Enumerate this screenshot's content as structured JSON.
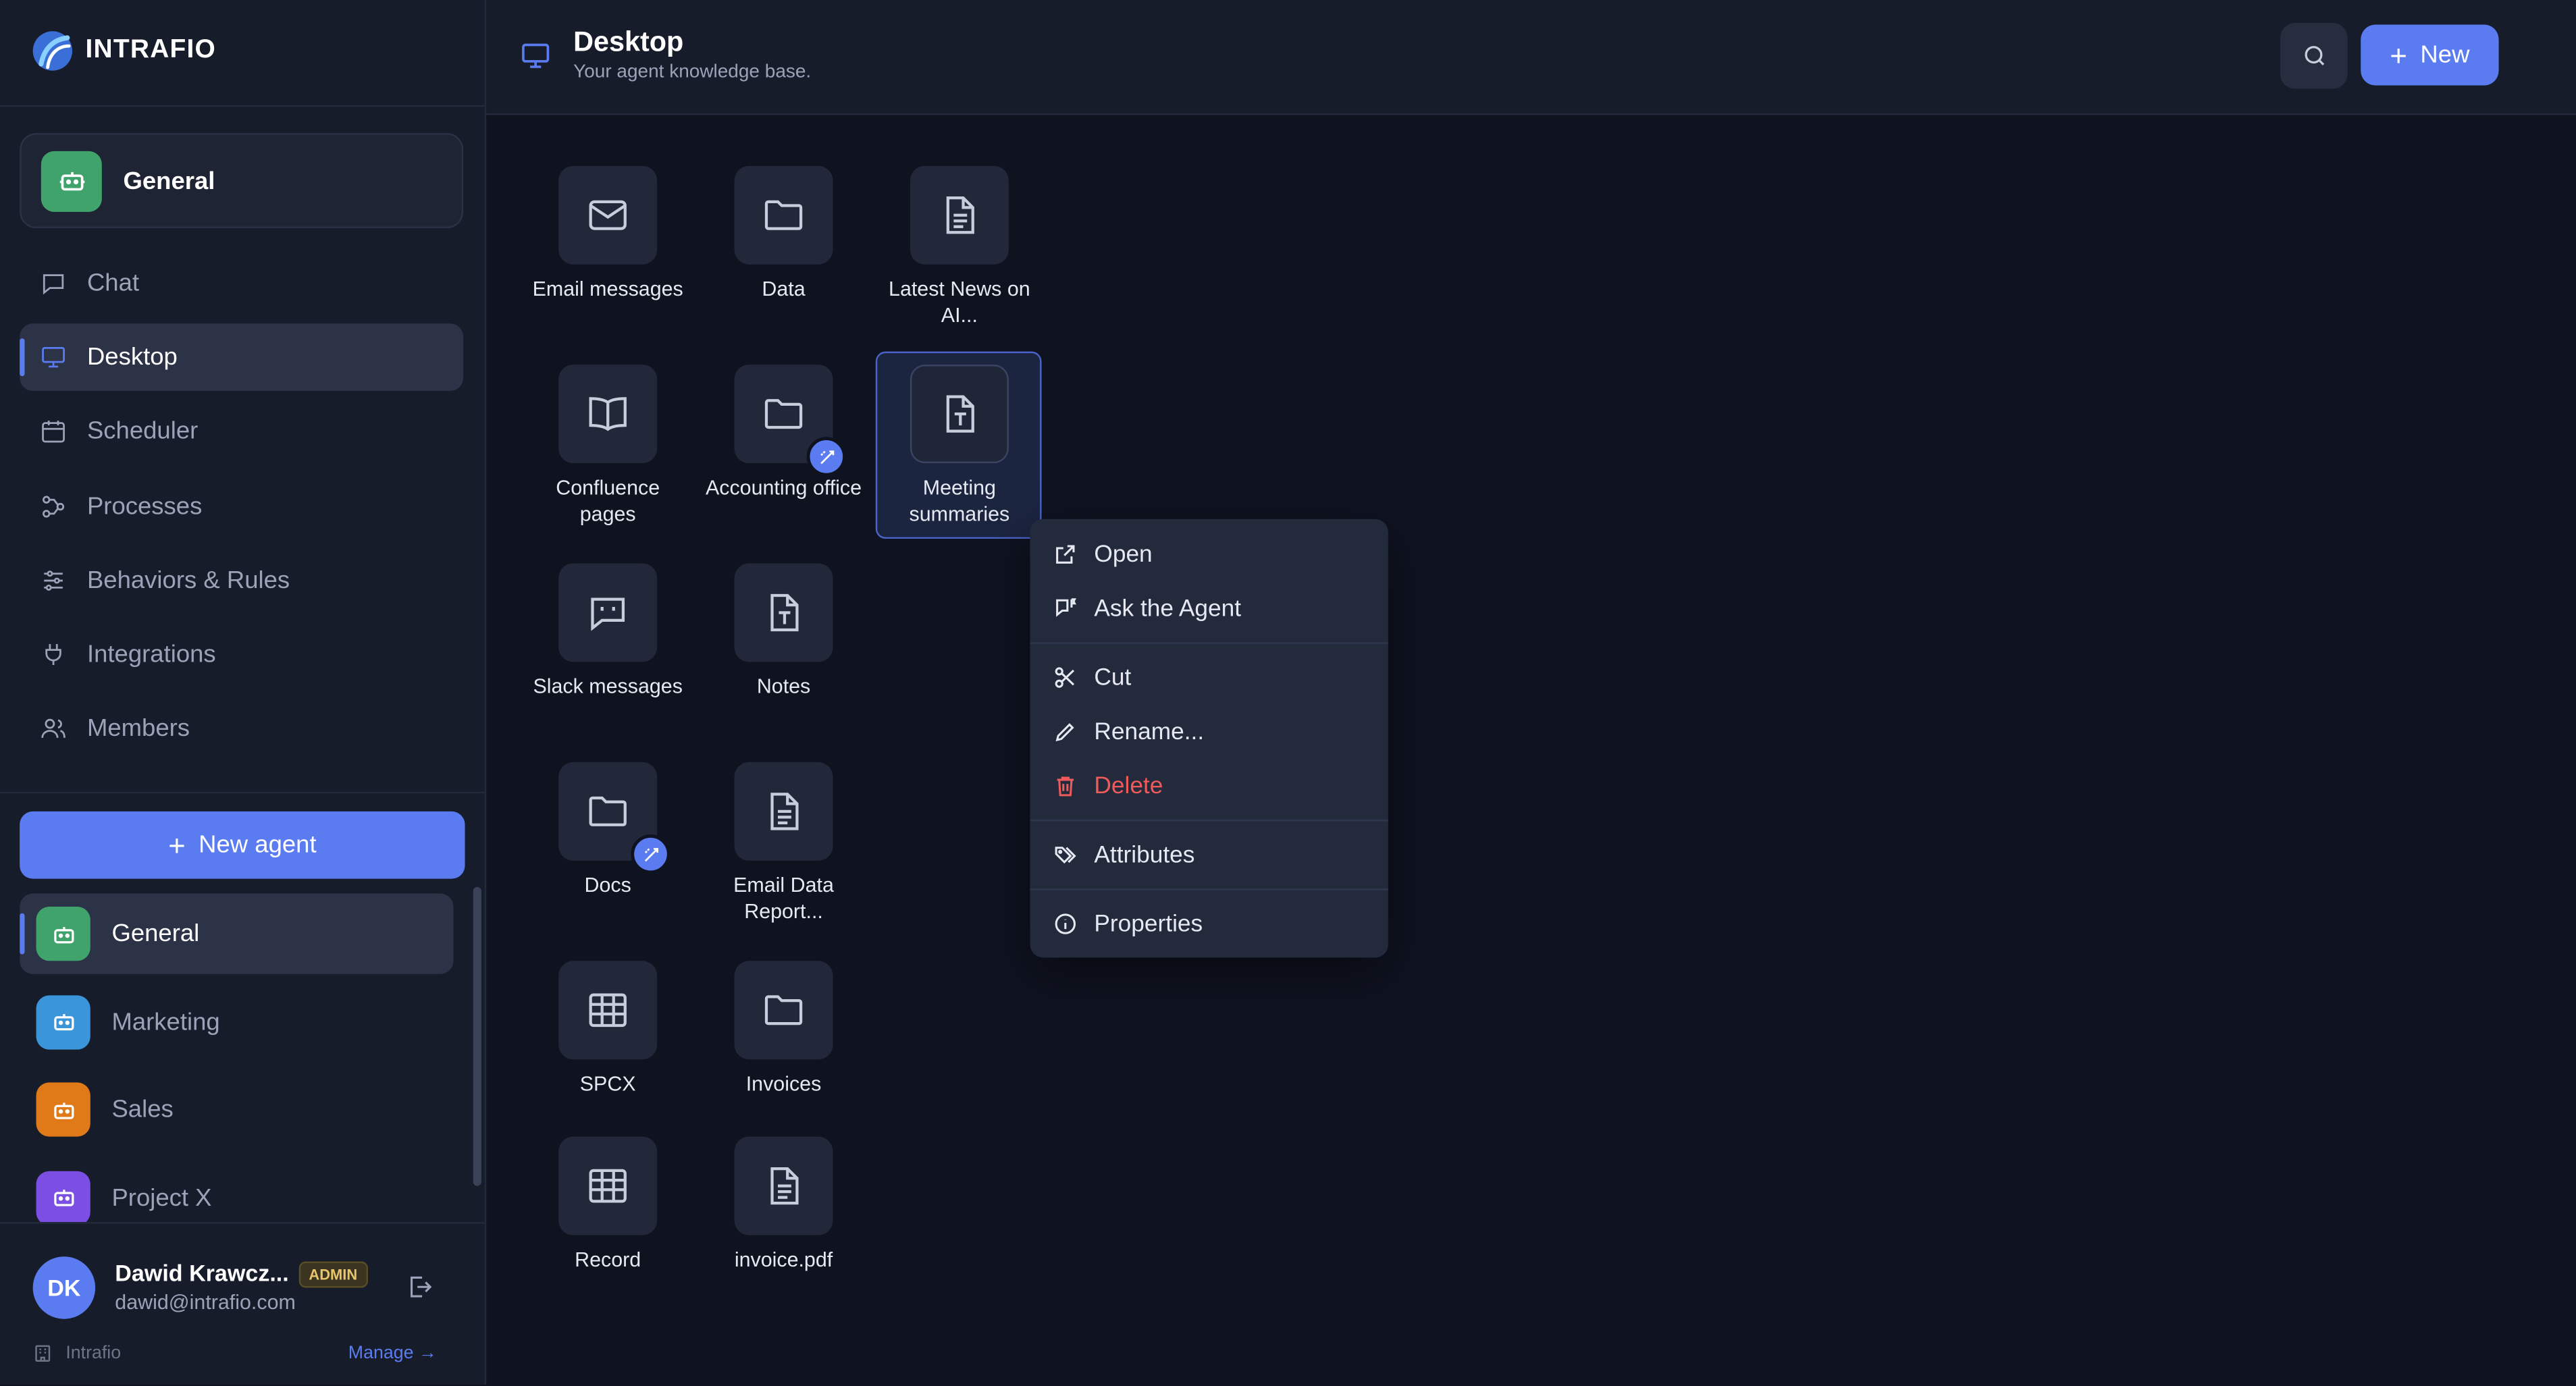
{
  "brand": {
    "name": "INTRAFIO"
  },
  "workspace": {
    "name": "General"
  },
  "nav": [
    {
      "label": "Chat",
      "icon": "chat-icon"
    },
    {
      "label": "Desktop",
      "icon": "monitor-icon",
      "active": true
    },
    {
      "label": "Scheduler",
      "icon": "calendar-icon"
    },
    {
      "label": "Processes",
      "icon": "workflow-icon"
    },
    {
      "label": "Behaviors & Rules",
      "icon": "sliders-icon"
    },
    {
      "label": "Integrations",
      "icon": "plug-icon"
    },
    {
      "label": "Members",
      "icon": "users-icon"
    }
  ],
  "new_agent_label": "New agent",
  "agents": [
    {
      "name": "General",
      "color": "#3fa36b",
      "active": true
    },
    {
      "name": "Marketing",
      "color": "#3b95d9"
    },
    {
      "name": "Sales",
      "color": "#e07a18"
    },
    {
      "name": "Project X",
      "color": "#7b4fe3"
    }
  ],
  "user": {
    "name": "Dawid Krawcz...",
    "initials": "DK",
    "role": "ADMIN",
    "email": "dawid@intrafio.com",
    "org": "Intrafio",
    "manage_label": "Manage →"
  },
  "header": {
    "title": "Desktop",
    "subtitle": "Your agent knowledge base.",
    "new_label": "New"
  },
  "items": [
    {
      "label": "Email messages",
      "icon": "mail-icon",
      "col": 0,
      "row": 0
    },
    {
      "label": "Data",
      "icon": "folder-icon",
      "col": 1,
      "row": 0
    },
    {
      "label": "Latest News on AI...",
      "icon": "document-icon",
      "col": 2,
      "row": 0
    },
    {
      "label": "Confluence pages",
      "icon": "book-icon",
      "col": 0,
      "row": 1
    },
    {
      "label": "Accounting office",
      "icon": "folder-icon",
      "col": 1,
      "row": 1,
      "badge": true
    },
    {
      "label": "Meeting summaries",
      "icon": "text-file-icon",
      "col": 2,
      "row": 1,
      "selected": true
    },
    {
      "label": "Slack messages",
      "icon": "quote-message-icon",
      "col": 0,
      "row": 2
    },
    {
      "label": "Notes",
      "icon": "text-file-icon",
      "col": 1,
      "row": 2
    },
    {
      "label": "Docs",
      "icon": "folder-icon",
      "col": 0,
      "row": 3,
      "badge": true
    },
    {
      "label": "Email Data Report...",
      "icon": "document-icon",
      "col": 1,
      "row": 3
    },
    {
      "label": "SPCX",
      "icon": "table-icon",
      "col": 0,
      "row": 4
    },
    {
      "label": "Invoices",
      "icon": "folder-icon",
      "col": 1,
      "row": 4
    },
    {
      "label": "Record",
      "icon": "table-icon",
      "col": 0,
      "row": 5
    },
    {
      "label": "invoice.pdf",
      "icon": "document-icon",
      "col": 1,
      "row": 5
    }
  ],
  "context_menu": [
    {
      "label": "Open",
      "icon": "external-link-icon"
    },
    {
      "label": "Ask the Agent",
      "icon": "chat-flag-icon"
    },
    {
      "separator": true
    },
    {
      "label": "Cut",
      "icon": "scissors-icon"
    },
    {
      "label": "Rename...",
      "icon": "pencil-icon"
    },
    {
      "label": "Delete",
      "icon": "trash-icon",
      "danger": true
    },
    {
      "separator": true
    },
    {
      "label": "Attributes",
      "icon": "tags-icon"
    },
    {
      "separator": true
    },
    {
      "label": "Properties",
      "icon": "info-icon"
    }
  ],
  "colors": {
    "accent": "#5b7cf0",
    "danger": "#ef5a5a",
    "background": "#0f1320",
    "sidebar": "#171c2b"
  }
}
